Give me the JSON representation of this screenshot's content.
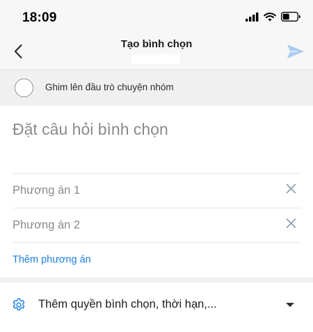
{
  "status_bar": {
    "time": "18:09",
    "icons": [
      "signal-icon",
      "wifi-icon",
      "battery-icon"
    ]
  },
  "nav": {
    "back_icon": "chevron-left-icon",
    "title": "Tạo bình chọn",
    "send_icon": "send-icon"
  },
  "pin": {
    "label": "Ghim lên đầu trò chuyện nhóm",
    "checked": false
  },
  "question": {
    "placeholder": "Đặt câu hỏi bình chọn",
    "value": ""
  },
  "options": [
    {
      "placeholder": "Phương án 1",
      "value": ""
    },
    {
      "placeholder": "Phương án 2",
      "value": ""
    }
  ],
  "add_option_label": "Thêm phương án",
  "settings": {
    "icon": "gear-icon",
    "label": "Thêm quyền bình chọn, thời hạn,..."
  },
  "colors": {
    "accent": "#1a7fe0",
    "send_disabled": "#a9cdf2",
    "clear_icon": "#8e9bb0"
  }
}
